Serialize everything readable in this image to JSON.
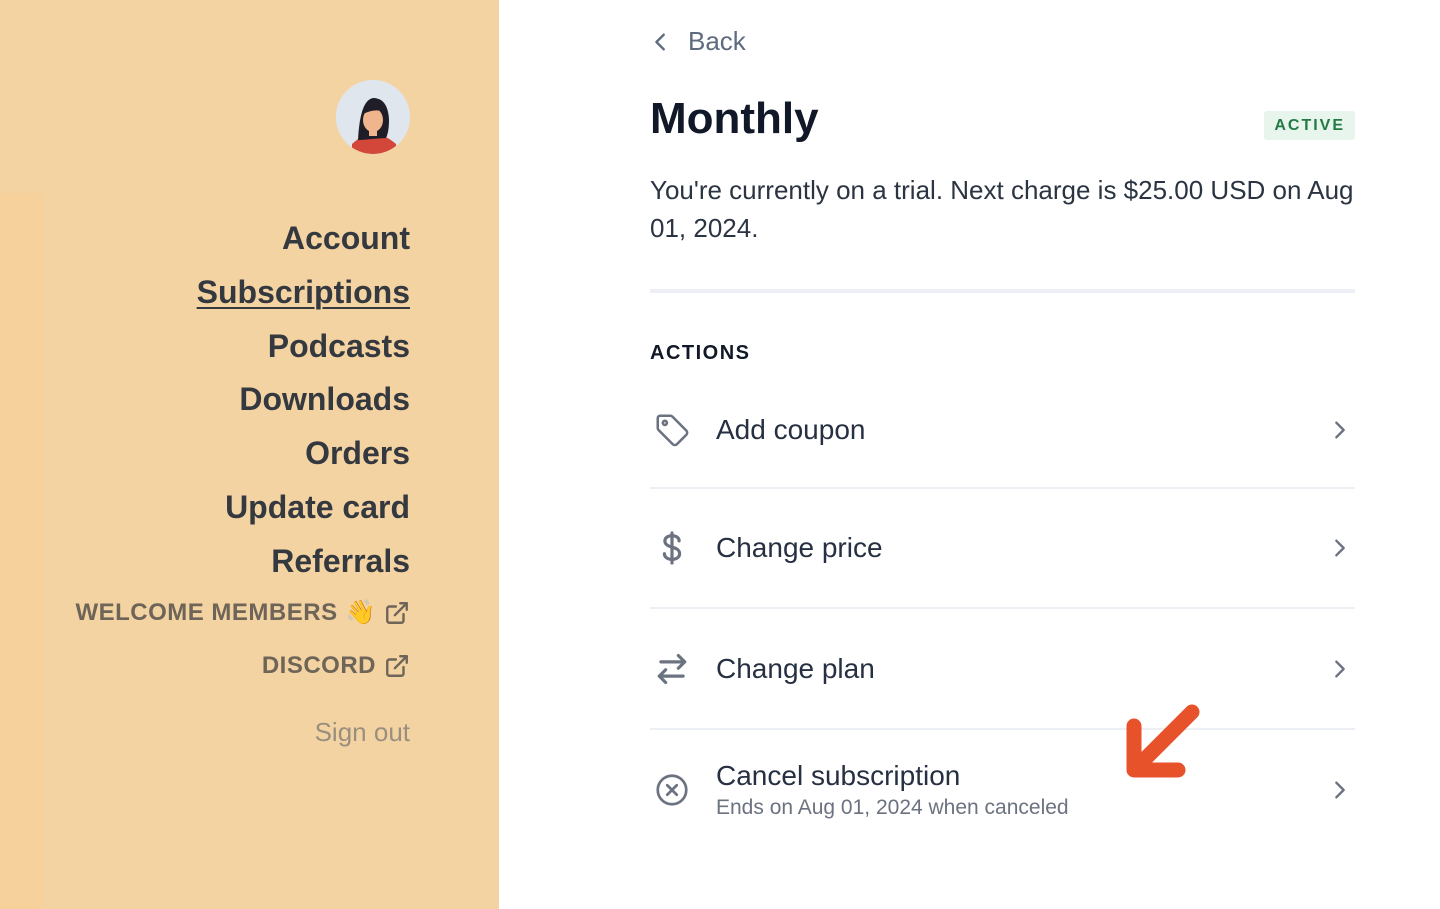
{
  "sidebar": {
    "nav_items": [
      {
        "label": "Account",
        "active": false
      },
      {
        "label": "Subscriptions",
        "active": true
      },
      {
        "label": "Podcasts",
        "active": false
      },
      {
        "label": "Downloads",
        "active": false
      },
      {
        "label": "Orders",
        "active": false
      },
      {
        "label": "Update card",
        "active": false
      },
      {
        "label": "Referrals",
        "active": false
      }
    ],
    "welcome_link": {
      "label": "WELCOME MEMBERS",
      "emoji": "👋",
      "icon": "external-link-icon"
    },
    "discord_link": {
      "label": "DISCORD",
      "icon": "external-link-icon"
    },
    "signout_label": "Sign out",
    "avatar_icon": "user-avatar"
  },
  "main": {
    "back_label": "Back",
    "title": "Monthly",
    "status_badge": "ACTIVE",
    "trial_text": "You're currently on a trial. Next charge is $25.00 USD on Aug 01, 2024.",
    "actions_heading": "ACTIONS",
    "actions": [
      {
        "label": "Add coupon",
        "icon": "tag-icon"
      },
      {
        "label": "Change price",
        "icon": "dollar-icon"
      },
      {
        "label": "Change plan",
        "icon": "swap-arrows-icon"
      },
      {
        "label": "Cancel subscription",
        "sublabel": "Ends on Aug 01, 2024 when canceled",
        "icon": "circle-x-icon"
      }
    ]
  },
  "colors": {
    "sidebar_bg": "#f4d3a3",
    "badge_bg": "#e8f5ec",
    "badge_text": "#237a45",
    "annotation_arrow": "#e8522b"
  }
}
